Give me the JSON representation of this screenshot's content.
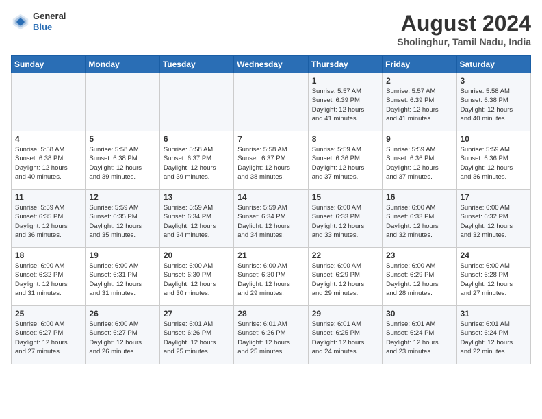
{
  "logo": {
    "general": "General",
    "blue": "Blue"
  },
  "title": {
    "month_year": "August 2024",
    "location": "Sholinghur, Tamil Nadu, India"
  },
  "days_of_week": [
    "Sunday",
    "Monday",
    "Tuesday",
    "Wednesday",
    "Thursday",
    "Friday",
    "Saturday"
  ],
  "weeks": [
    [
      {
        "day": "",
        "info": ""
      },
      {
        "day": "",
        "info": ""
      },
      {
        "day": "",
        "info": ""
      },
      {
        "day": "",
        "info": ""
      },
      {
        "day": "1",
        "info": "Sunrise: 5:57 AM\nSunset: 6:39 PM\nDaylight: 12 hours\nand 41 minutes."
      },
      {
        "day": "2",
        "info": "Sunrise: 5:57 AM\nSunset: 6:39 PM\nDaylight: 12 hours\nand 41 minutes."
      },
      {
        "day": "3",
        "info": "Sunrise: 5:58 AM\nSunset: 6:38 PM\nDaylight: 12 hours\nand 40 minutes."
      }
    ],
    [
      {
        "day": "4",
        "info": "Sunrise: 5:58 AM\nSunset: 6:38 PM\nDaylight: 12 hours\nand 40 minutes."
      },
      {
        "day": "5",
        "info": "Sunrise: 5:58 AM\nSunset: 6:38 PM\nDaylight: 12 hours\nand 39 minutes."
      },
      {
        "day": "6",
        "info": "Sunrise: 5:58 AM\nSunset: 6:37 PM\nDaylight: 12 hours\nand 39 minutes."
      },
      {
        "day": "7",
        "info": "Sunrise: 5:58 AM\nSunset: 6:37 PM\nDaylight: 12 hours\nand 38 minutes."
      },
      {
        "day": "8",
        "info": "Sunrise: 5:59 AM\nSunset: 6:36 PM\nDaylight: 12 hours\nand 37 minutes."
      },
      {
        "day": "9",
        "info": "Sunrise: 5:59 AM\nSunset: 6:36 PM\nDaylight: 12 hours\nand 37 minutes."
      },
      {
        "day": "10",
        "info": "Sunrise: 5:59 AM\nSunset: 6:36 PM\nDaylight: 12 hours\nand 36 minutes."
      }
    ],
    [
      {
        "day": "11",
        "info": "Sunrise: 5:59 AM\nSunset: 6:35 PM\nDaylight: 12 hours\nand 36 minutes."
      },
      {
        "day": "12",
        "info": "Sunrise: 5:59 AM\nSunset: 6:35 PM\nDaylight: 12 hours\nand 35 minutes."
      },
      {
        "day": "13",
        "info": "Sunrise: 5:59 AM\nSunset: 6:34 PM\nDaylight: 12 hours\nand 34 minutes."
      },
      {
        "day": "14",
        "info": "Sunrise: 5:59 AM\nSunset: 6:34 PM\nDaylight: 12 hours\nand 34 minutes."
      },
      {
        "day": "15",
        "info": "Sunrise: 6:00 AM\nSunset: 6:33 PM\nDaylight: 12 hours\nand 33 minutes."
      },
      {
        "day": "16",
        "info": "Sunrise: 6:00 AM\nSunset: 6:33 PM\nDaylight: 12 hours\nand 32 minutes."
      },
      {
        "day": "17",
        "info": "Sunrise: 6:00 AM\nSunset: 6:32 PM\nDaylight: 12 hours\nand 32 minutes."
      }
    ],
    [
      {
        "day": "18",
        "info": "Sunrise: 6:00 AM\nSunset: 6:32 PM\nDaylight: 12 hours\nand 31 minutes."
      },
      {
        "day": "19",
        "info": "Sunrise: 6:00 AM\nSunset: 6:31 PM\nDaylight: 12 hours\nand 31 minutes."
      },
      {
        "day": "20",
        "info": "Sunrise: 6:00 AM\nSunset: 6:30 PM\nDaylight: 12 hours\nand 30 minutes."
      },
      {
        "day": "21",
        "info": "Sunrise: 6:00 AM\nSunset: 6:30 PM\nDaylight: 12 hours\nand 29 minutes."
      },
      {
        "day": "22",
        "info": "Sunrise: 6:00 AM\nSunset: 6:29 PM\nDaylight: 12 hours\nand 29 minutes."
      },
      {
        "day": "23",
        "info": "Sunrise: 6:00 AM\nSunset: 6:29 PM\nDaylight: 12 hours\nand 28 minutes."
      },
      {
        "day": "24",
        "info": "Sunrise: 6:00 AM\nSunset: 6:28 PM\nDaylight: 12 hours\nand 27 minutes."
      }
    ],
    [
      {
        "day": "25",
        "info": "Sunrise: 6:00 AM\nSunset: 6:27 PM\nDaylight: 12 hours\nand 27 minutes."
      },
      {
        "day": "26",
        "info": "Sunrise: 6:00 AM\nSunset: 6:27 PM\nDaylight: 12 hours\nand 26 minutes."
      },
      {
        "day": "27",
        "info": "Sunrise: 6:01 AM\nSunset: 6:26 PM\nDaylight: 12 hours\nand 25 minutes."
      },
      {
        "day": "28",
        "info": "Sunrise: 6:01 AM\nSunset: 6:26 PM\nDaylight: 12 hours\nand 25 minutes."
      },
      {
        "day": "29",
        "info": "Sunrise: 6:01 AM\nSunset: 6:25 PM\nDaylight: 12 hours\nand 24 minutes."
      },
      {
        "day": "30",
        "info": "Sunrise: 6:01 AM\nSunset: 6:24 PM\nDaylight: 12 hours\nand 23 minutes."
      },
      {
        "day": "31",
        "info": "Sunrise: 6:01 AM\nSunset: 6:24 PM\nDaylight: 12 hours\nand 22 minutes."
      }
    ]
  ]
}
